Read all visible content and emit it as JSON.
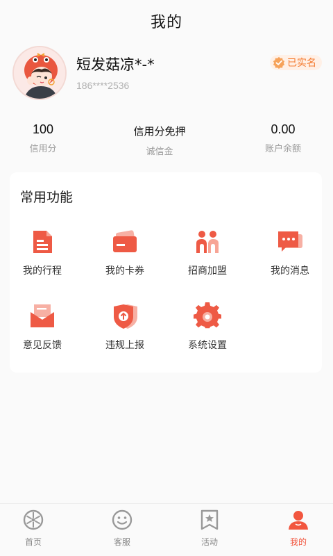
{
  "header": {
    "title": "我的"
  },
  "profile": {
    "nickname": "短发菇凉*-*",
    "phone": "186****2536",
    "verified_label": "已实名",
    "avatar_icon": "cartoon-avatar"
  },
  "stats": [
    {
      "value": "100",
      "label": "信用分"
    },
    {
      "value": "信用分免押",
      "label": "诚信金"
    },
    {
      "value": "0.00",
      "label": "账户余额"
    }
  ],
  "features": {
    "title": "常用功能",
    "items": [
      {
        "label": "我的行程",
        "icon": "document-icon"
      },
      {
        "label": "我的卡券",
        "icon": "card-icon"
      },
      {
        "label": "招商加盟",
        "icon": "partners-icon"
      },
      {
        "label": "我的消息",
        "icon": "message-icon"
      },
      {
        "label": "意见反馈",
        "icon": "mail-feedback-icon"
      },
      {
        "label": "违规上报",
        "icon": "shield-report-icon"
      },
      {
        "label": "系统设置",
        "icon": "gear-icon"
      }
    ]
  },
  "tabbar": {
    "items": [
      {
        "label": "首页",
        "icon": "wheel-icon"
      },
      {
        "label": "客服",
        "icon": "smile-icon"
      },
      {
        "label": "活动",
        "icon": "star-bookmark-icon"
      },
      {
        "label": "我的",
        "icon": "person-icon"
      }
    ],
    "active": "我的"
  },
  "colors": {
    "accent": "#f2563f",
    "badge": "#f47a2f",
    "muted": "#999999"
  }
}
